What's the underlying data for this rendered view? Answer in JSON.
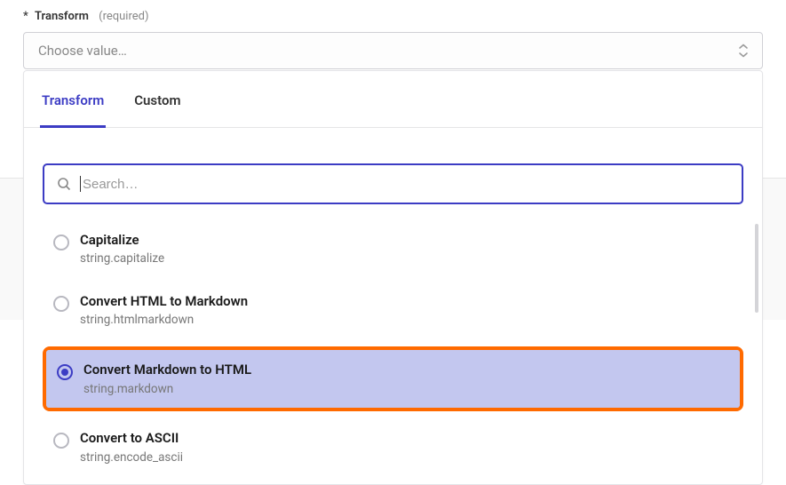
{
  "field": {
    "asterisk": "*",
    "label": "Transform",
    "required": "(required)",
    "placeholder": "Choose value…"
  },
  "tabs": {
    "transform": "Transform",
    "custom": "Custom"
  },
  "search": {
    "placeholder": "Search…"
  },
  "options": [
    {
      "title": "Capitalize",
      "sub": "string.capitalize",
      "selected": false
    },
    {
      "title": "Convert HTML to Markdown",
      "sub": "string.htmlmarkdown",
      "selected": false
    },
    {
      "title": "Convert Markdown to HTML",
      "sub": "string.markdown",
      "selected": true
    },
    {
      "title": "Convert to ASCII",
      "sub": "string.encode_ascii",
      "selected": false
    }
  ]
}
